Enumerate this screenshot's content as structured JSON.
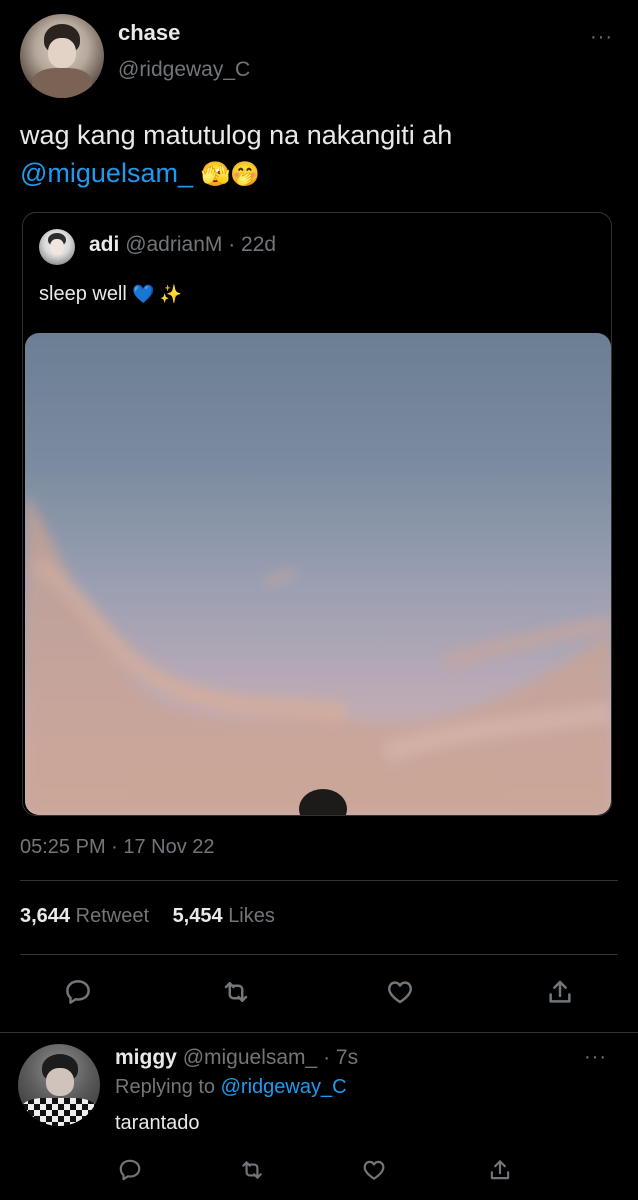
{
  "tweet": {
    "author_name": "chase",
    "author_handle": "@ridgeway_C",
    "text": "wag kang matutulog na nakangiti ah",
    "mention": "@miguelsam_",
    "emojis": "🫣🤭",
    "timestamp": "05:25 PM · 17 Nov 22",
    "more_icon": "more-horizontal-icon",
    "stats": {
      "retweets_count": "3,644",
      "retweets_label": "Retweet",
      "likes_count": "5,454",
      "likes_label": "Likes"
    }
  },
  "quoted": {
    "author_name": "adi",
    "author_handle": "@adrianM",
    "time": "· 22d",
    "text": "sleep well",
    "emojis": "💙 ✨"
  },
  "actions": [
    "reply-icon",
    "retweet-icon",
    "like-icon",
    "share-icon"
  ],
  "reply": {
    "author_name": "miggy",
    "author_handle": "@miguelsam_",
    "time": "· 7s",
    "replying_prefix": "Replying to",
    "replying_to": "@ridgeway_C",
    "text": "tarantado"
  },
  "colors": {
    "background": "#000000",
    "text": "#e7e9ea",
    "muted": "#71767b",
    "accent": "#1d9bf0",
    "border": "#2f3336"
  }
}
